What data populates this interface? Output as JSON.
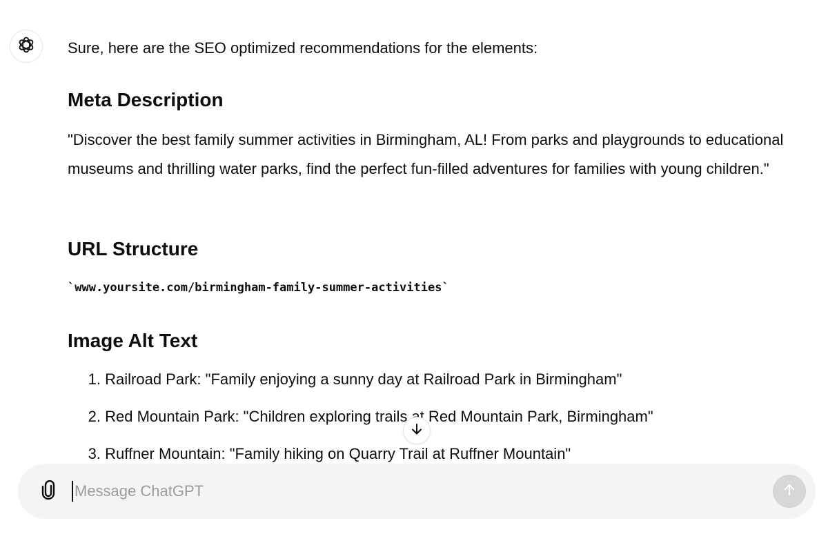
{
  "assistant": {
    "avatar_icon": "openai-logo-icon",
    "intro": "Sure, here are the SEO optimized recommendations for the elements:",
    "sections": {
      "meta": {
        "heading": "Meta Description",
        "text": "\"Discover the best family summer activities in Birmingham, AL! From parks and playgrounds to educational museums and thrilling water parks, find the perfect fun-filled adventures for families with young children.\""
      },
      "url": {
        "heading": "URL Structure",
        "code": "`www.yoursite.com/birmingham-family-summer-activities`"
      },
      "alt": {
        "heading": "Image Alt Text",
        "items": [
          {
            "num": "1.",
            "text": "Railroad Park: \"Family enjoying a sunny day at Railroad Park in Birmingham\""
          },
          {
            "num": "2.",
            "text": "Red Mountain Park: \"Children exploring trails at Red Mountain Park, Birmingham\""
          },
          {
            "num": "3.",
            "text": "Ruffner Mountain: \"Family hiking on Quarry Trail at Ruffner Mountain\""
          }
        ]
      }
    }
  },
  "scroll_button": {
    "icon": "arrow-down-icon"
  },
  "composer": {
    "placeholder": "Message ChatGPT",
    "value": "",
    "attach_icon": "paperclip-icon",
    "send_icon": "arrow-up-icon"
  },
  "colors": {
    "composer_bg": "#f4f4f4",
    "send_disabled": "#d7d7d7",
    "text": "#0d0d0d",
    "placeholder": "#9b9b9b"
  }
}
